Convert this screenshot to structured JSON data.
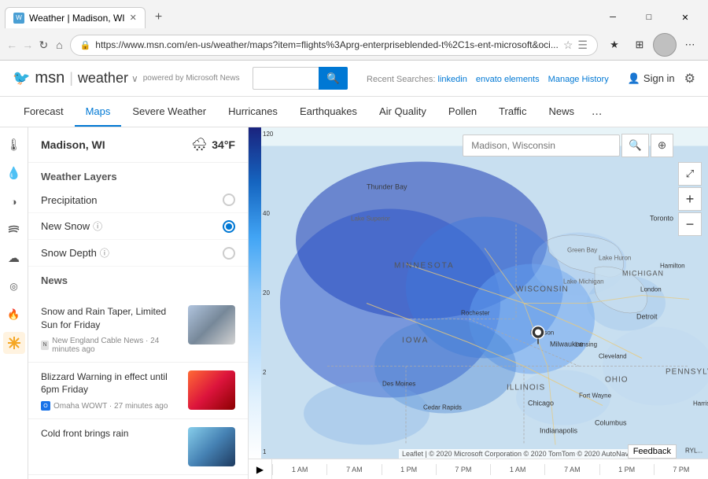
{
  "browser": {
    "tab_title": "Weather | Madison, WI",
    "url": "https://www.msn.com/en-us/weather/maps?item=flights%3Aprg-enterpriseblended-t%2C1s-ent-microsoft&oci...",
    "new_tab_btn": "+",
    "window_controls": {
      "minimize": "─",
      "maximize": "□",
      "close": "✕"
    },
    "nav_back": "←",
    "nav_forward": "→",
    "nav_refresh": "↻",
    "nav_home": "⌂"
  },
  "msn": {
    "logo_text": "msn",
    "divider": "|",
    "weather_label": "weather",
    "dropdown_arrow": "~",
    "powered_by": "powered by Microsoft News",
    "search_placeholder": "",
    "search_btn_icon": "🔍",
    "recent_searches_label": "Recent Searches:",
    "recent_search_1": "linkedin",
    "recent_search_2": "envato elements",
    "manage_history": "Manage History"
  },
  "header_right": {
    "sign_in": "Sign in",
    "account_icon": "👤",
    "settings_icon": "⚙"
  },
  "nav_tabs": {
    "tabs": [
      {
        "label": "Forecast",
        "active": false
      },
      {
        "label": "Maps",
        "active": true
      },
      {
        "label": "Severe Weather",
        "active": false
      },
      {
        "label": "Hurricanes",
        "active": false
      },
      {
        "label": "Earthquakes",
        "active": false
      },
      {
        "label": "Air Quality",
        "active": false
      },
      {
        "label": "Pollen",
        "active": false
      },
      {
        "label": "Traffic",
        "active": false
      },
      {
        "label": "News",
        "active": false
      }
    ],
    "more": "..."
  },
  "left_sidebar": {
    "icons": [
      {
        "name": "thermometer",
        "glyph": "🌡",
        "active": false
      },
      {
        "name": "water-drop",
        "glyph": "💧",
        "active": false
      },
      {
        "name": "moon",
        "glyph": "◑",
        "active": false
      },
      {
        "name": "wind",
        "glyph": "💨",
        "active": false
      },
      {
        "name": "cloud",
        "glyph": "☁",
        "active": false
      },
      {
        "name": "eye",
        "glyph": "◎",
        "active": false
      },
      {
        "name": "flame",
        "glyph": "🔥",
        "active": false
      },
      {
        "name": "snow-active",
        "glyph": "❄",
        "active": true
      }
    ]
  },
  "weather_panel": {
    "location": "Madison, WI",
    "weather_icon": "🌨",
    "temperature": "34°F",
    "layers_title": "Weather Layers",
    "layers": [
      {
        "label": "Precipitation",
        "info": false,
        "selected": false
      },
      {
        "label": "New Snow",
        "info": true,
        "selected": true
      },
      {
        "label": "Snow Depth",
        "info": true,
        "selected": false
      }
    ],
    "news_title": "News",
    "news_items": [
      {
        "title": "Snow and Rain Taper, Limited Sun for Friday",
        "source": "New England Cable News",
        "time": "24 minutes ago",
        "thumb_type": "snow"
      },
      {
        "title": "Blizzard Warning in effect until 6pm Friday",
        "source": "Omaha WOWT",
        "time": "27 minutes ago",
        "thumb_type": "blizzard"
      },
      {
        "title": "Cold front brings rain",
        "source": "",
        "time": "",
        "thumb_type": "cold"
      }
    ]
  },
  "map": {
    "search_placeholder": "Madison, Wisconsin",
    "search_icon": "🔍",
    "location_icon": "⊕",
    "expand_icon": "⤢",
    "zoom_in": "+",
    "zoom_out": "−",
    "attribution": "Leaflet | © 2020 Microsoft Corporation © 2020 TomTom © 2020 AutoNav...",
    "feedback": "Feedback",
    "location_labels": [
      "Thunder Bay",
      "Lake Superior",
      "MINNESOTA",
      "WISCONSIN",
      "Green Bay",
      "Lake Michigan",
      "Lake Huron",
      "MICHIGAN",
      "Toronto",
      "Hamilton",
      "London",
      "Detroit",
      "IOWA",
      "Rochester",
      "Madison",
      "Milwaukee",
      "ILLINOIS",
      "Chicago",
      "Lansing",
      "Cleveland",
      "OHIO",
      "Indianapolis",
      "Columbus",
      "Fort Wayne",
      "Des Moines",
      "Cedar Rapids",
      "PENNSYLVANIA",
      "Harrisburg"
    ]
  },
  "timeline": {
    "play_icon": "▶",
    "ticks": [
      "1 AM",
      "7 AM",
      "1 PM",
      "7 PM",
      "1 AM",
      "7 AM",
      "1 PM",
      "7 PM"
    ]
  },
  "snow_scale": {
    "labels": [
      "120",
      "40",
      "20",
      "2",
      "1"
    ]
  },
  "colors": {
    "accent": "#0078d4",
    "tab_active": "#0078d4",
    "snow_blue_dark": "#1a237e",
    "snow_blue_mid": "#42a5f5",
    "snow_blue_light": "#bbdefb",
    "map_water": "#d0e8f8",
    "map_land": "#f5f5dc"
  }
}
